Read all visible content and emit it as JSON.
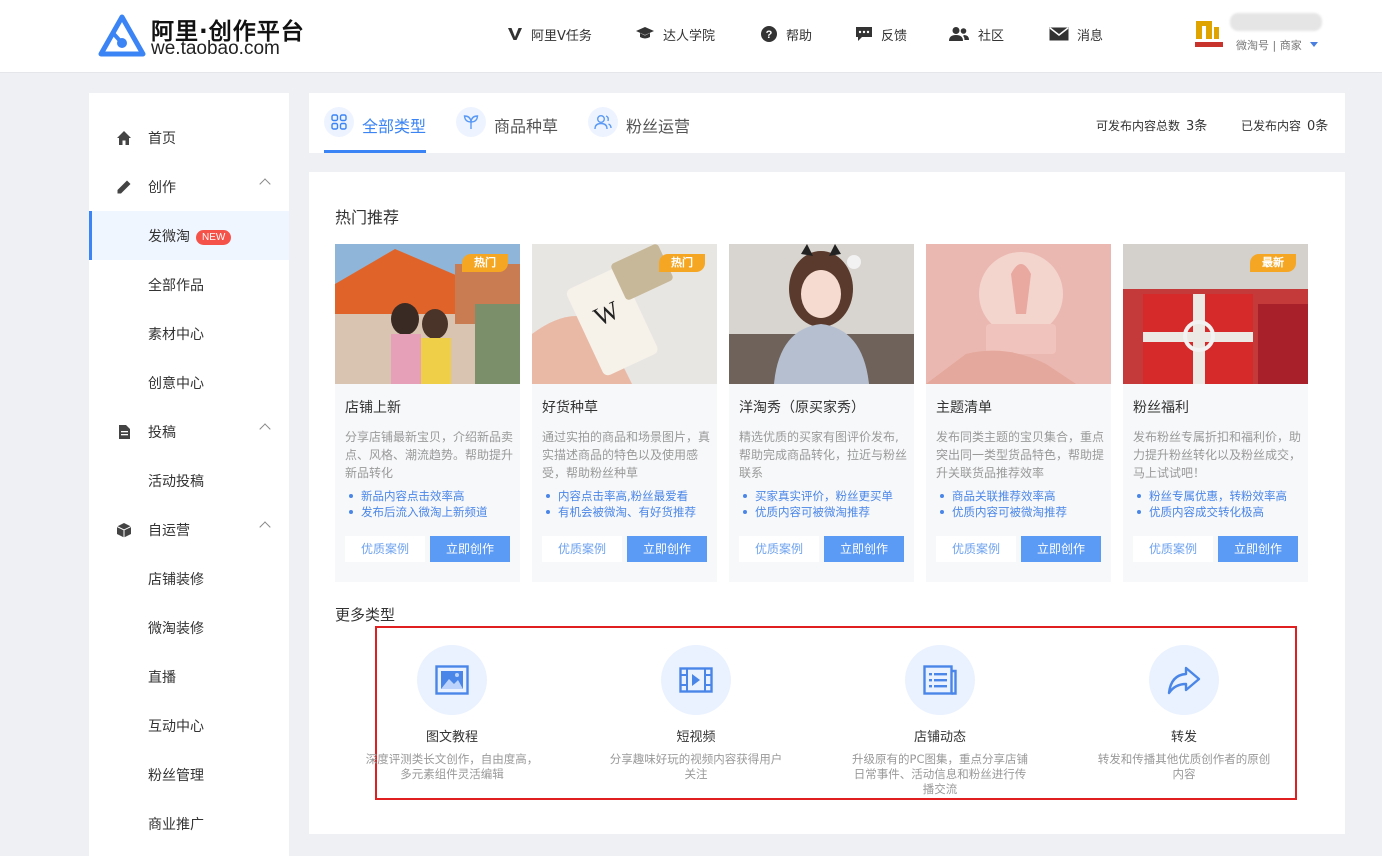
{
  "header": {
    "logo_title": "阿里·创作平台",
    "logo_sub": "we.taobao.com",
    "nav": [
      {
        "label": "阿里V任务",
        "icon": "v-icon"
      },
      {
        "label": "达人学院",
        "icon": "graduation-cap-icon"
      },
      {
        "label": "帮助",
        "icon": "help-icon"
      },
      {
        "label": "反馈",
        "icon": "feedback-icon"
      },
      {
        "label": "社区",
        "icon": "community-icon"
      },
      {
        "label": "消息",
        "icon": "mail-icon"
      }
    ],
    "user_role": "微淘号 | 商家"
  },
  "sidebar": {
    "items": [
      {
        "label": "首页",
        "icon": "home-icon"
      },
      {
        "label": "创作",
        "icon": "pencil-icon"
      },
      {
        "label": "发微淘",
        "badge": "NEW"
      },
      {
        "label": "全部作品"
      },
      {
        "label": "素材中心"
      },
      {
        "label": "创意中心"
      },
      {
        "label": "投稿",
        "icon": "document-icon"
      },
      {
        "label": "活动投稿"
      },
      {
        "label": "自运营",
        "icon": "box-icon"
      },
      {
        "label": "店铺装修"
      },
      {
        "label": "微淘装修"
      },
      {
        "label": "直播"
      },
      {
        "label": "互动中心"
      },
      {
        "label": "粉丝管理"
      },
      {
        "label": "商业推广"
      }
    ]
  },
  "tabs": [
    {
      "label": "全部类型",
      "icon": "grid-icon"
    },
    {
      "label": "商品种草",
      "icon": "sprout-icon"
    },
    {
      "label": "粉丝运营",
      "icon": "users-icon"
    }
  ],
  "stats": {
    "publishable_label": "可发布内容总数",
    "publishable_value": "3条",
    "published_label": "已发布内容",
    "published_value": "0条"
  },
  "hot": {
    "title": "热门推荐",
    "case_label": "优质案例",
    "create_label": "立即创作",
    "cards": [
      {
        "title": "店铺上新",
        "tag": "热门",
        "desc": "分享店铺最新宝贝，介绍新品卖点、风格、潮流趋势。帮助提升新品转化",
        "bullets": [
          "新品内容点击效率高",
          "发布后流入微淘上新频道"
        ]
      },
      {
        "title": "好货种草",
        "tag": "热门",
        "desc": "通过实拍的商品和场景图片，真实描述商品的特色以及使用感受，帮助粉丝种草",
        "bullets": [
          "内容点击率高,粉丝最爱看",
          "有机会被微淘、有好货推荐"
        ]
      },
      {
        "title": "洋淘秀（原买家秀）",
        "tag": "",
        "desc": "精选优质的买家有图评价发布,帮助完成商品转化，拉近与粉丝联系",
        "bullets": [
          "买家真实评价，粉丝更买单",
          "优质内容可被微淘推荐"
        ]
      },
      {
        "title": "主题清单",
        "tag": "",
        "desc": "发布同类主题的宝贝集合，重点突出同一类型货品特色，帮助提升关联货品推荐效率",
        "bullets": [
          "商品关联推荐效率高",
          "优质内容可被微淘推荐"
        ]
      },
      {
        "title": "粉丝福利",
        "tag": "最新",
        "desc": "发布粉丝专属折扣和福利价，助力提升粉丝转化以及粉丝成交，马上试试吧！",
        "bullets": [
          "粉丝专属优惠，转粉效率高",
          "优质内容成交转化极高"
        ]
      }
    ]
  },
  "more": {
    "title": "更多类型",
    "items": [
      {
        "title": "图文教程",
        "desc": "深度评测类长文创作，自由度高，多元素组件灵活编辑",
        "icon": "image-icon"
      },
      {
        "title": "短视频",
        "desc": "分享趣味好玩的视频内容获得用户关注",
        "icon": "video-icon"
      },
      {
        "title": "店铺动态",
        "desc": "升级原有的PC图集，重点分享店铺日常事件、活动信息和粉丝进行传播交流",
        "icon": "list-icon"
      },
      {
        "title": "转发",
        "desc": "转发和传播其他优质创作者的原创内容",
        "icon": "share-icon"
      }
    ]
  }
}
